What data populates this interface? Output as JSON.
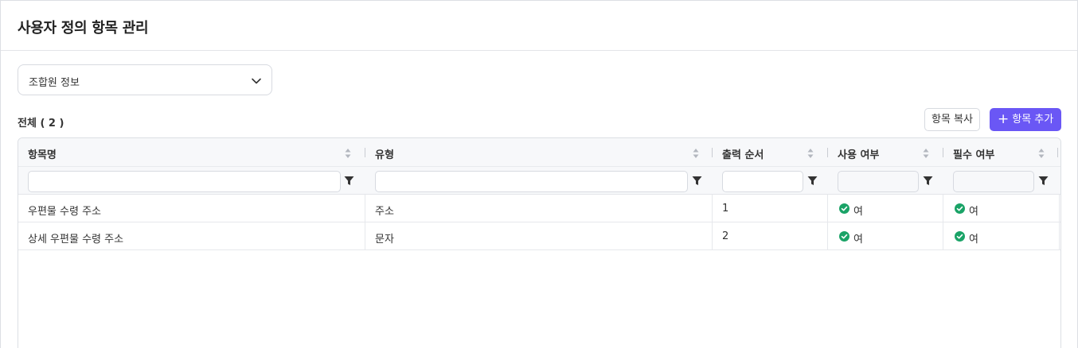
{
  "page": {
    "title": "사용자 정의 항목 관리"
  },
  "category_select": {
    "value": "조합원 정보",
    "icon": "chevron-down-icon"
  },
  "summary": {
    "total_label": "전체 ( 2 )"
  },
  "toolbar": {
    "copy_label": "항목 복사",
    "add_label": "항목 추가",
    "add_icon": "plus-icon",
    "accent_color": "#6a57f5"
  },
  "grid": {
    "columns": [
      {
        "key": "name",
        "label": "항목명"
      },
      {
        "key": "type",
        "label": "유형"
      },
      {
        "key": "order",
        "label": "출력 순서"
      },
      {
        "key": "use",
        "label": "사용 여부"
      },
      {
        "key": "required",
        "label": "필수 여부"
      }
    ],
    "filters": {
      "name": "",
      "type": "",
      "order": "",
      "use": "",
      "required": ""
    },
    "rows": [
      {
        "name": "우편물 수령 주소",
        "type": "주소",
        "order": "1",
        "use": "여",
        "required": "여"
      },
      {
        "name": "상세 우편물 수령 주소",
        "type": "문자",
        "order": "2",
        "use": "여",
        "required": "여"
      }
    ],
    "status_color": "#1aa367"
  }
}
